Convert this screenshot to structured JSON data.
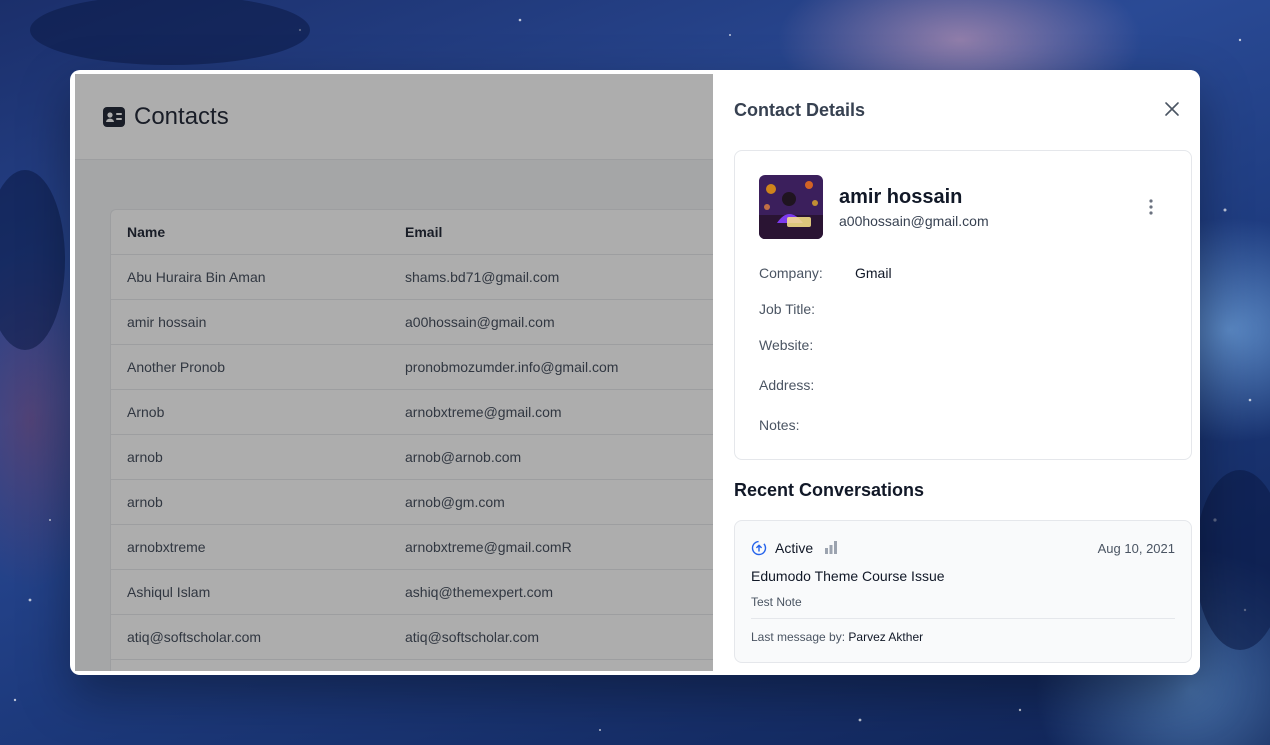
{
  "list": {
    "title": "Contacts",
    "columns": [
      "Name",
      "Email"
    ],
    "rows": [
      {
        "name": "Abu Huraira Bin Aman",
        "email": "shams.bd71@gmail.com"
      },
      {
        "name": "amir hossain",
        "email": "a00hossain@gmail.com"
      },
      {
        "name": "Another Pronob",
        "email": "pronobmozumder.info@gmail.com"
      },
      {
        "name": "Arnob",
        "email": "arnobxtreme@gmail.com"
      },
      {
        "name": "arnob",
        "email": "arnob@arnob.com"
      },
      {
        "name": "arnob",
        "email": "arnob@gm.com"
      },
      {
        "name": "arnobxtreme",
        "email": "arnobxtreme@gmail.comR"
      },
      {
        "name": "Ashiqul Islam",
        "email": "ashiq@themexpert.com"
      },
      {
        "name": "atiq@softscholar.com",
        "email": "atiq@softscholar.com"
      }
    ]
  },
  "details": {
    "title": "Contact Details",
    "close_icon": "close-icon",
    "contact": {
      "name": "amir hossain",
      "email": "a00hossain@gmail.com",
      "more_icon": "kebab-menu-icon"
    },
    "fields": [
      {
        "label": "Company:",
        "value": "Gmail"
      },
      {
        "label": "Job Title:",
        "value": ""
      },
      {
        "label": "Website:",
        "value": ""
      },
      {
        "label": "Address:",
        "value": ""
      },
      {
        "label": "Notes:",
        "value": ""
      }
    ],
    "recent_title": "Recent Conversations",
    "conversation": {
      "status": "Active",
      "date": "Aug 10, 2021",
      "subject": "Edumodo Theme Course Issue",
      "note": "Test Note",
      "last_message_label": "Last message by:",
      "last_message_author": "Parvez Akther"
    }
  },
  "colors": {
    "accent_blue": "#2563eb",
    "text_primary": "#111827",
    "text_secondary": "#4b5563",
    "border": "#e5e7eb"
  }
}
